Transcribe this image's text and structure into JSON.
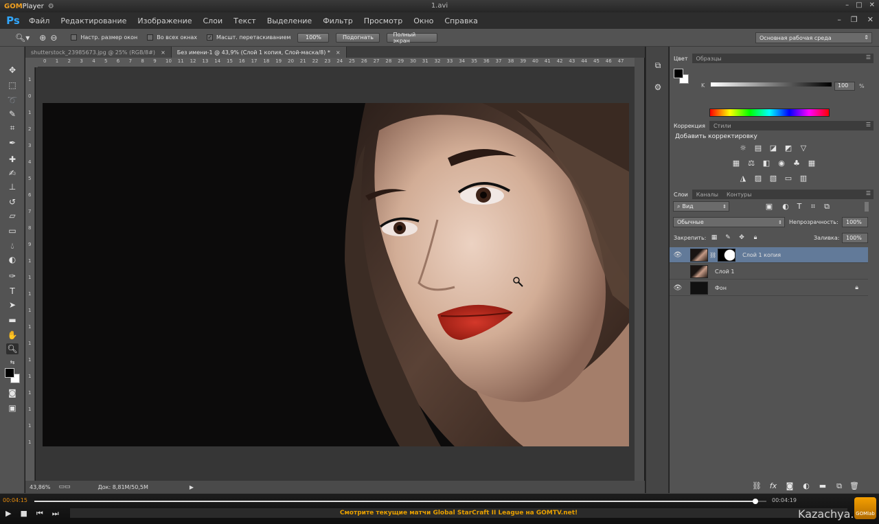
{
  "player": {
    "brand": "GOM",
    "brand_suffix": "Player",
    "window_title": "1.avi",
    "time_current": "00:04:15",
    "time_total": "00:04:19",
    "progress_fraction": 0.985,
    "ticker": "Смотрите текущие матчи Global StarCraft II League на GOMTV.net!",
    "logo_label": "GOMlab",
    "watermark": "Kazachya.net"
  },
  "menu": {
    "logo": "Ps",
    "items": [
      "Файл",
      "Редактирование",
      "Изображение",
      "Слои",
      "Текст",
      "Выделение",
      "Фильтр",
      "Просмотр",
      "Окно",
      "Справка"
    ]
  },
  "options": {
    "checkbox_resize_label": "Настр. размер окон",
    "checkbox_resize_checked": false,
    "checkbox_all_label": "Во всех окнах",
    "checkbox_all_checked": false,
    "checkbox_scrubby_label": "Масшт. перетаскиванием",
    "checkbox_scrubby_checked": true,
    "btn_100": "100%",
    "btn_fit": "Подогнать",
    "btn_fullscreen": "Полный экран",
    "workspace": "Основная рабочая среда"
  },
  "tabs": [
    {
      "label": "shutterstock_23985673.jpg @ 25% (RGB/8#)",
      "close": "×"
    },
    {
      "label": "Без имени-1 @ 43,9% (Слой 1 копия, Слой-маска/8) *",
      "close": "×"
    }
  ],
  "rulers": {
    "top": [
      "0",
      "1",
      "2",
      "3",
      "4",
      "5",
      "6",
      "7",
      "8",
      "9",
      "10",
      "11",
      "12",
      "13",
      "14",
      "15",
      "16",
      "17",
      "18",
      "19",
      "20",
      "21",
      "22",
      "23",
      "24",
      "25",
      "26",
      "27",
      "28",
      "29",
      "30",
      "31",
      "32",
      "33",
      "34",
      "35",
      "36",
      "37",
      "38",
      "39",
      "40",
      "41",
      "42",
      "43",
      "44",
      "45",
      "46",
      "47"
    ],
    "left": [
      "1",
      "0",
      "1",
      "2",
      "3",
      "4",
      "5",
      "6",
      "7",
      "8",
      "9",
      "1",
      "1",
      "1",
      "1",
      "1",
      "1",
      "1",
      "1",
      "1",
      "1",
      "1",
      "1"
    ]
  },
  "status": {
    "zoom": "43,86%",
    "doc": "Док: 8,81M/50,5M"
  },
  "color_panel": {
    "tabs": [
      "Цвет",
      "Образцы"
    ],
    "channel": "K",
    "value": "100",
    "unit": "%"
  },
  "adjust_panel": {
    "tabs": [
      "Коррекция",
      "Стили"
    ],
    "heading": "Добавить корректировку"
  },
  "layers_panel": {
    "tabs": [
      "Слои",
      "Каналы",
      "Контуры"
    ],
    "filter": "Вид",
    "blend_mode": "Обычные",
    "opacity_label": "Непрозрачность:",
    "opacity": "100%",
    "lock_label": "Закрепить:",
    "fill_label": "Заливка:",
    "fill": "100%",
    "layers": [
      {
        "name": "Слой 1 копия",
        "visible": true,
        "selected": true
      },
      {
        "name": "Слой 1",
        "visible": false,
        "selected": false
      },
      {
        "name": "Фон",
        "visible": true,
        "selected": false
      }
    ]
  },
  "colors": {
    "ps_blue": "#31a8ff",
    "gom_orange": "#e88c0c",
    "layer_selected": "#627a99",
    "lips_red": "#b51e12"
  }
}
